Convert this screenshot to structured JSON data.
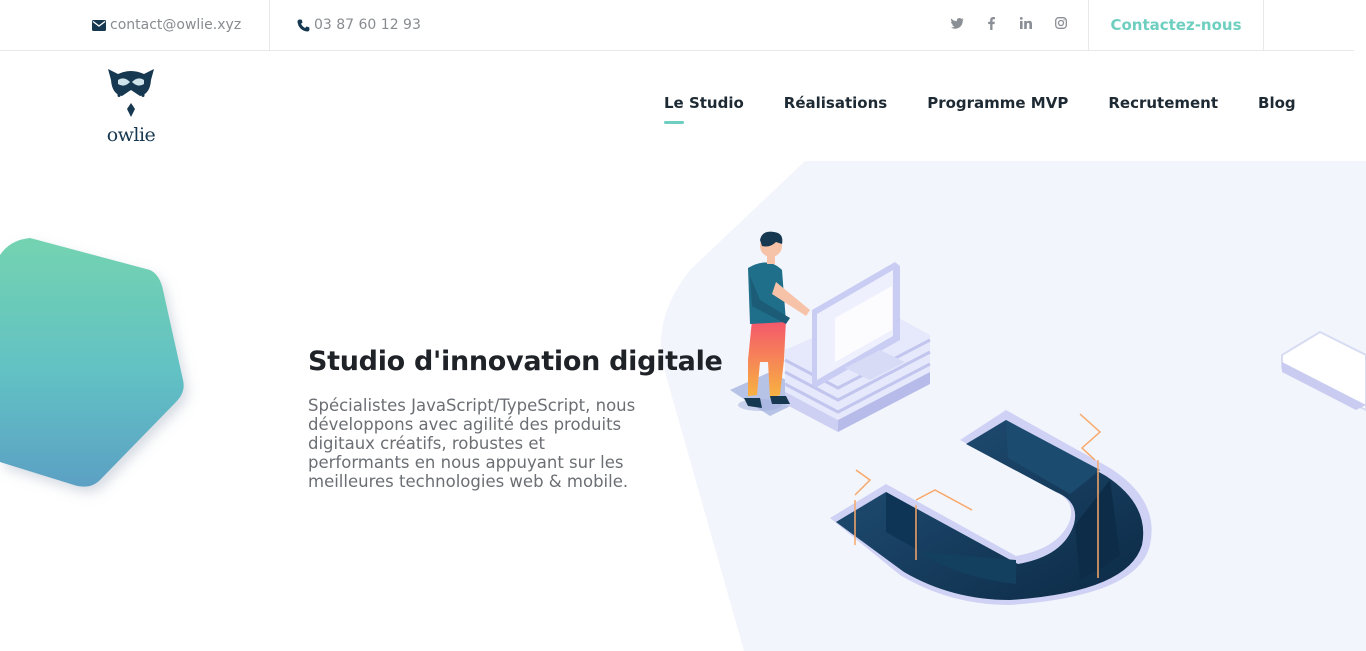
{
  "topbar": {
    "email": "contact@owlie.xyz",
    "phone": "03 87 60 12 93",
    "social": [
      {
        "name": "twitter",
        "icon": "twitter-icon"
      },
      {
        "name": "facebook",
        "icon": "facebook-icon"
      },
      {
        "name": "linkedin",
        "icon": "linkedin-icon"
      },
      {
        "name": "instagram",
        "icon": "instagram-icon"
      }
    ],
    "contact_label": "Contactez-nous"
  },
  "header": {
    "logo_text": "owlie",
    "nav": [
      {
        "label": "Le Studio",
        "active": true
      },
      {
        "label": "Réalisations",
        "active": false
      },
      {
        "label": "Programme MVP",
        "active": false
      },
      {
        "label": "Recrutement",
        "active": false
      },
      {
        "label": "Blog",
        "active": false
      }
    ]
  },
  "hero": {
    "title": "Studio d'innovation digitale",
    "description": "Spécialistes JavaScript/TypeScript, nous développons avec agilité des produits digitaux créatifs, robustes et performants en nous appuyant sur les meilleures technologies web & mobile."
  },
  "colors": {
    "accent": "#6ecfc0",
    "navy": "#163850",
    "text": "#1f2328",
    "muted": "#6b6f74"
  }
}
